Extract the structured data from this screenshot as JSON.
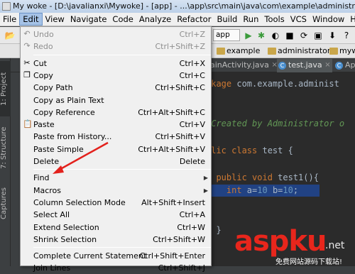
{
  "window": {
    "title": "My woke - [D:\\javalianxi\\Mywoke] - [app] - ...\\app\\src\\main\\java\\com\\example\\administrator\\mywoke"
  },
  "menubar": [
    "File",
    "Edit",
    "View",
    "Navigate",
    "Code",
    "Analyze",
    "Refactor",
    "Build",
    "Run",
    "Tools",
    "VCS",
    "Window",
    "Help"
  ],
  "toolbar": {
    "run_config": "app"
  },
  "navbar": {
    "crumbs": [
      "example",
      "administrator",
      "mywo"
    ]
  },
  "tabs": [
    {
      "label": "ainActivity.java"
    },
    {
      "label": "test.java",
      "icon": "C"
    },
    {
      "label": "Ap",
      "icon": "C"
    }
  ],
  "stripe": [
    "1: Project",
    "7: Structure",
    "Captures"
  ],
  "editor": {
    "lines": [
      {
        "parts": [
          [
            "kw",
            "ckage "
          ],
          [
            "",
            "com.example.administ"
          ]
        ]
      },
      {
        "parts": [
          [
            "cm",
            "*"
          ]
        ]
      },
      {
        "parts": [
          [
            "cm",
            " Created by Administrator o"
          ]
        ]
      },
      {
        "parts": [
          [
            "cm",
            "/"
          ]
        ]
      },
      {
        "parts": [
          [
            "kw",
            "blic class "
          ],
          [
            "",
            "test {"
          ]
        ]
      },
      {
        "parts": [
          [
            "kw",
            "  public void "
          ],
          [
            "",
            "test1(){"
          ]
        ]
      },
      {
        "parts": [
          [
            "kw",
            "    int "
          ],
          [
            "",
            "a="
          ],
          [
            "num",
            "10 "
          ],
          [
            "",
            "b="
          ],
          [
            "num",
            "10"
          ],
          [
            "",
            ";"
          ]
        ]
      },
      {
        "parts": [
          [
            "",
            "  }"
          ]
        ]
      }
    ]
  },
  "edit_menu": {
    "items": [
      {
        "label": "Undo",
        "shortcut": "Ctrl+Z",
        "disabled": true,
        "icon": "undo-icon"
      },
      {
        "label": "Redo",
        "shortcut": "Ctrl+Shift+Z",
        "disabled": true,
        "icon": "redo-icon"
      },
      {
        "sep": true
      },
      {
        "label": "Cut",
        "shortcut": "Ctrl+X",
        "icon": "cut-icon"
      },
      {
        "label": "Copy",
        "shortcut": "Ctrl+C",
        "icon": "copy-icon"
      },
      {
        "label": "Copy Path",
        "shortcut": "Ctrl+Shift+C"
      },
      {
        "label": "Copy as Plain Text",
        "shortcut": ""
      },
      {
        "label": "Copy Reference",
        "shortcut": "Ctrl+Alt+Shift+C"
      },
      {
        "label": "Paste",
        "shortcut": "Ctrl+V",
        "icon": "paste-icon"
      },
      {
        "label": "Paste from History...",
        "shortcut": "Ctrl+Shift+V"
      },
      {
        "label": "Paste Simple",
        "shortcut": "Ctrl+Alt+Shift+V"
      },
      {
        "label": "Delete",
        "shortcut": "Delete"
      },
      {
        "sep": true
      },
      {
        "label": "Find",
        "shortcut": "",
        "submenu": true
      },
      {
        "label": "Macros",
        "shortcut": "",
        "submenu": true
      },
      {
        "label": "Column Selection Mode",
        "shortcut": "Alt+Shift+Insert"
      },
      {
        "label": "Select All",
        "shortcut": "Ctrl+A"
      },
      {
        "label": "Extend Selection",
        "shortcut": "Ctrl+W"
      },
      {
        "label": "Shrink Selection",
        "shortcut": "Ctrl+Shift+W"
      },
      {
        "sep": true
      },
      {
        "label": "Complete Current Statement",
        "shortcut": "Ctrl+Shift+Enter"
      },
      {
        "label": "Join Lines",
        "shortcut": "Ctrl+Shift+J"
      }
    ]
  },
  "watermark": {
    "text": "aspku",
    "tld": ".net",
    "sub": "免费网站源码下载站!"
  },
  "colors": {
    "menu_highlight": "#a5c2e6",
    "editor_bg": "#2b2b2b",
    "arrow": "#e3211c"
  }
}
